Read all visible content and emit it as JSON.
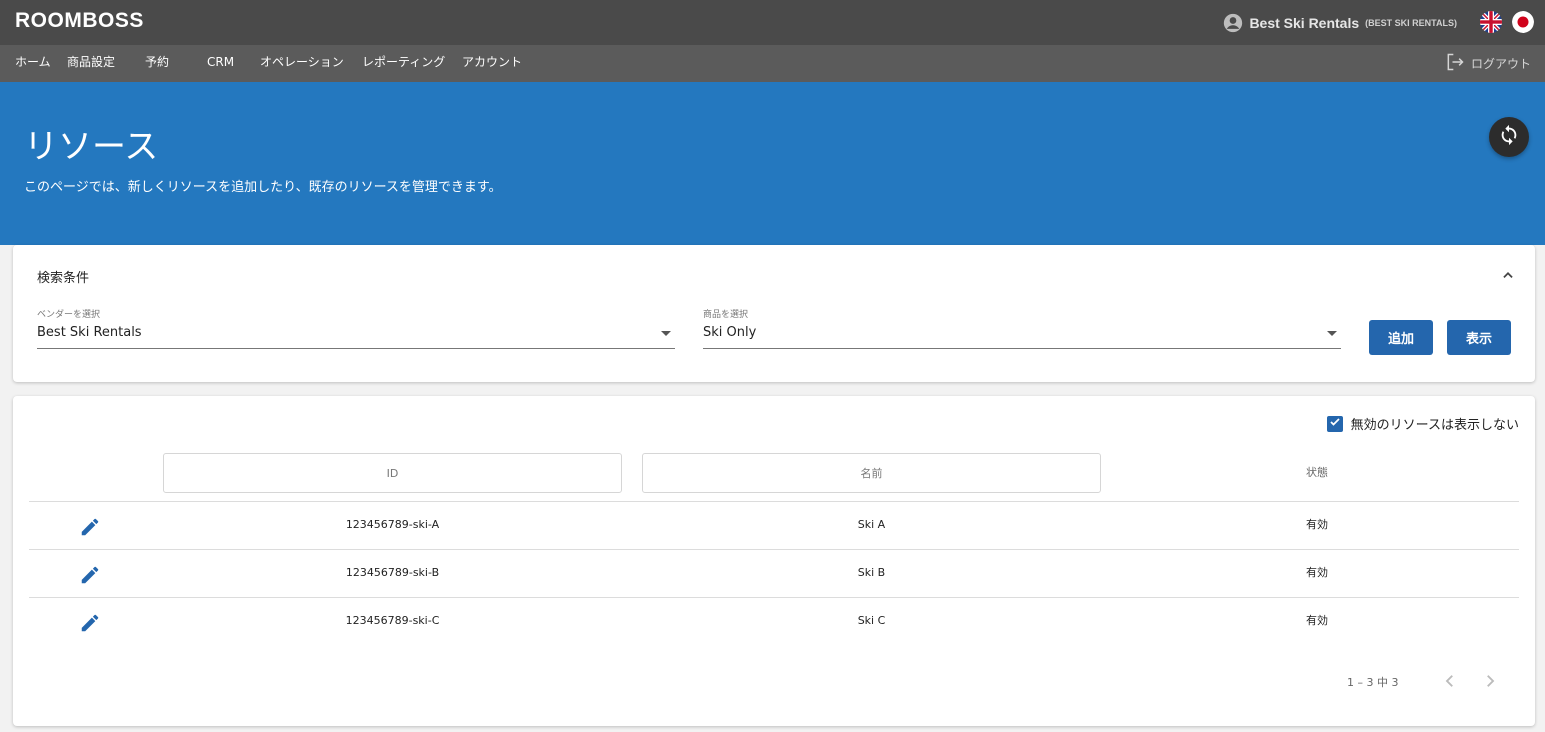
{
  "header": {
    "logo": "ROOMBOSS",
    "user_name": "Best Ski Rentals",
    "user_vendor": "(BEST SKI RENTALS)"
  },
  "nav": {
    "items": [
      "ホーム",
      "商品設定",
      "予約",
      "CRM",
      "オペレーション",
      "レポーティング",
      "アカウント"
    ],
    "logout": "ログアウト"
  },
  "banner": {
    "title": "リソース",
    "subtitle": "このページでは、新しくリソースを追加したり、既存のリソースを管理できます。"
  },
  "search": {
    "title": "検索条件",
    "vendor_label": "ベンダーを選択",
    "vendor_value": "Best Ski Rentals",
    "product_label": "商品を選択",
    "product_value": "Ski Only",
    "add_button": "追加",
    "show_button": "表示"
  },
  "table": {
    "hide_inactive_label": "無効のリソースは表示しない",
    "hide_inactive_checked": true,
    "filter_id_placeholder": "ID",
    "filter_name_placeholder": "名前",
    "status_header": "状態",
    "rows": [
      {
        "id": "123456789-ski-A",
        "name": "Ski A",
        "status": "有効"
      },
      {
        "id": "123456789-ski-B",
        "name": "Ski B",
        "status": "有効"
      },
      {
        "id": "123456789-ski-C",
        "name": "Ski C",
        "status": "有効"
      }
    ],
    "pagination": "1 – 3 中 3"
  },
  "colors": {
    "topbar": "#4a4a4a",
    "navbar": "#5b5b5b",
    "banner": "#2478bf",
    "primary_button": "#2466ad",
    "refresh_button": "#2c2c2c"
  },
  "icons": {
    "user": "account-circle-icon",
    "flag_en": "uk-flag-icon",
    "flag_ja": "japan-flag-icon",
    "logout": "logout-icon",
    "refresh": "refresh-icon",
    "collapse": "chevron-up-icon",
    "edit": "pencil-icon",
    "checkbox": "check-icon",
    "prev": "chevron-left-icon",
    "next": "chevron-right-icon"
  }
}
